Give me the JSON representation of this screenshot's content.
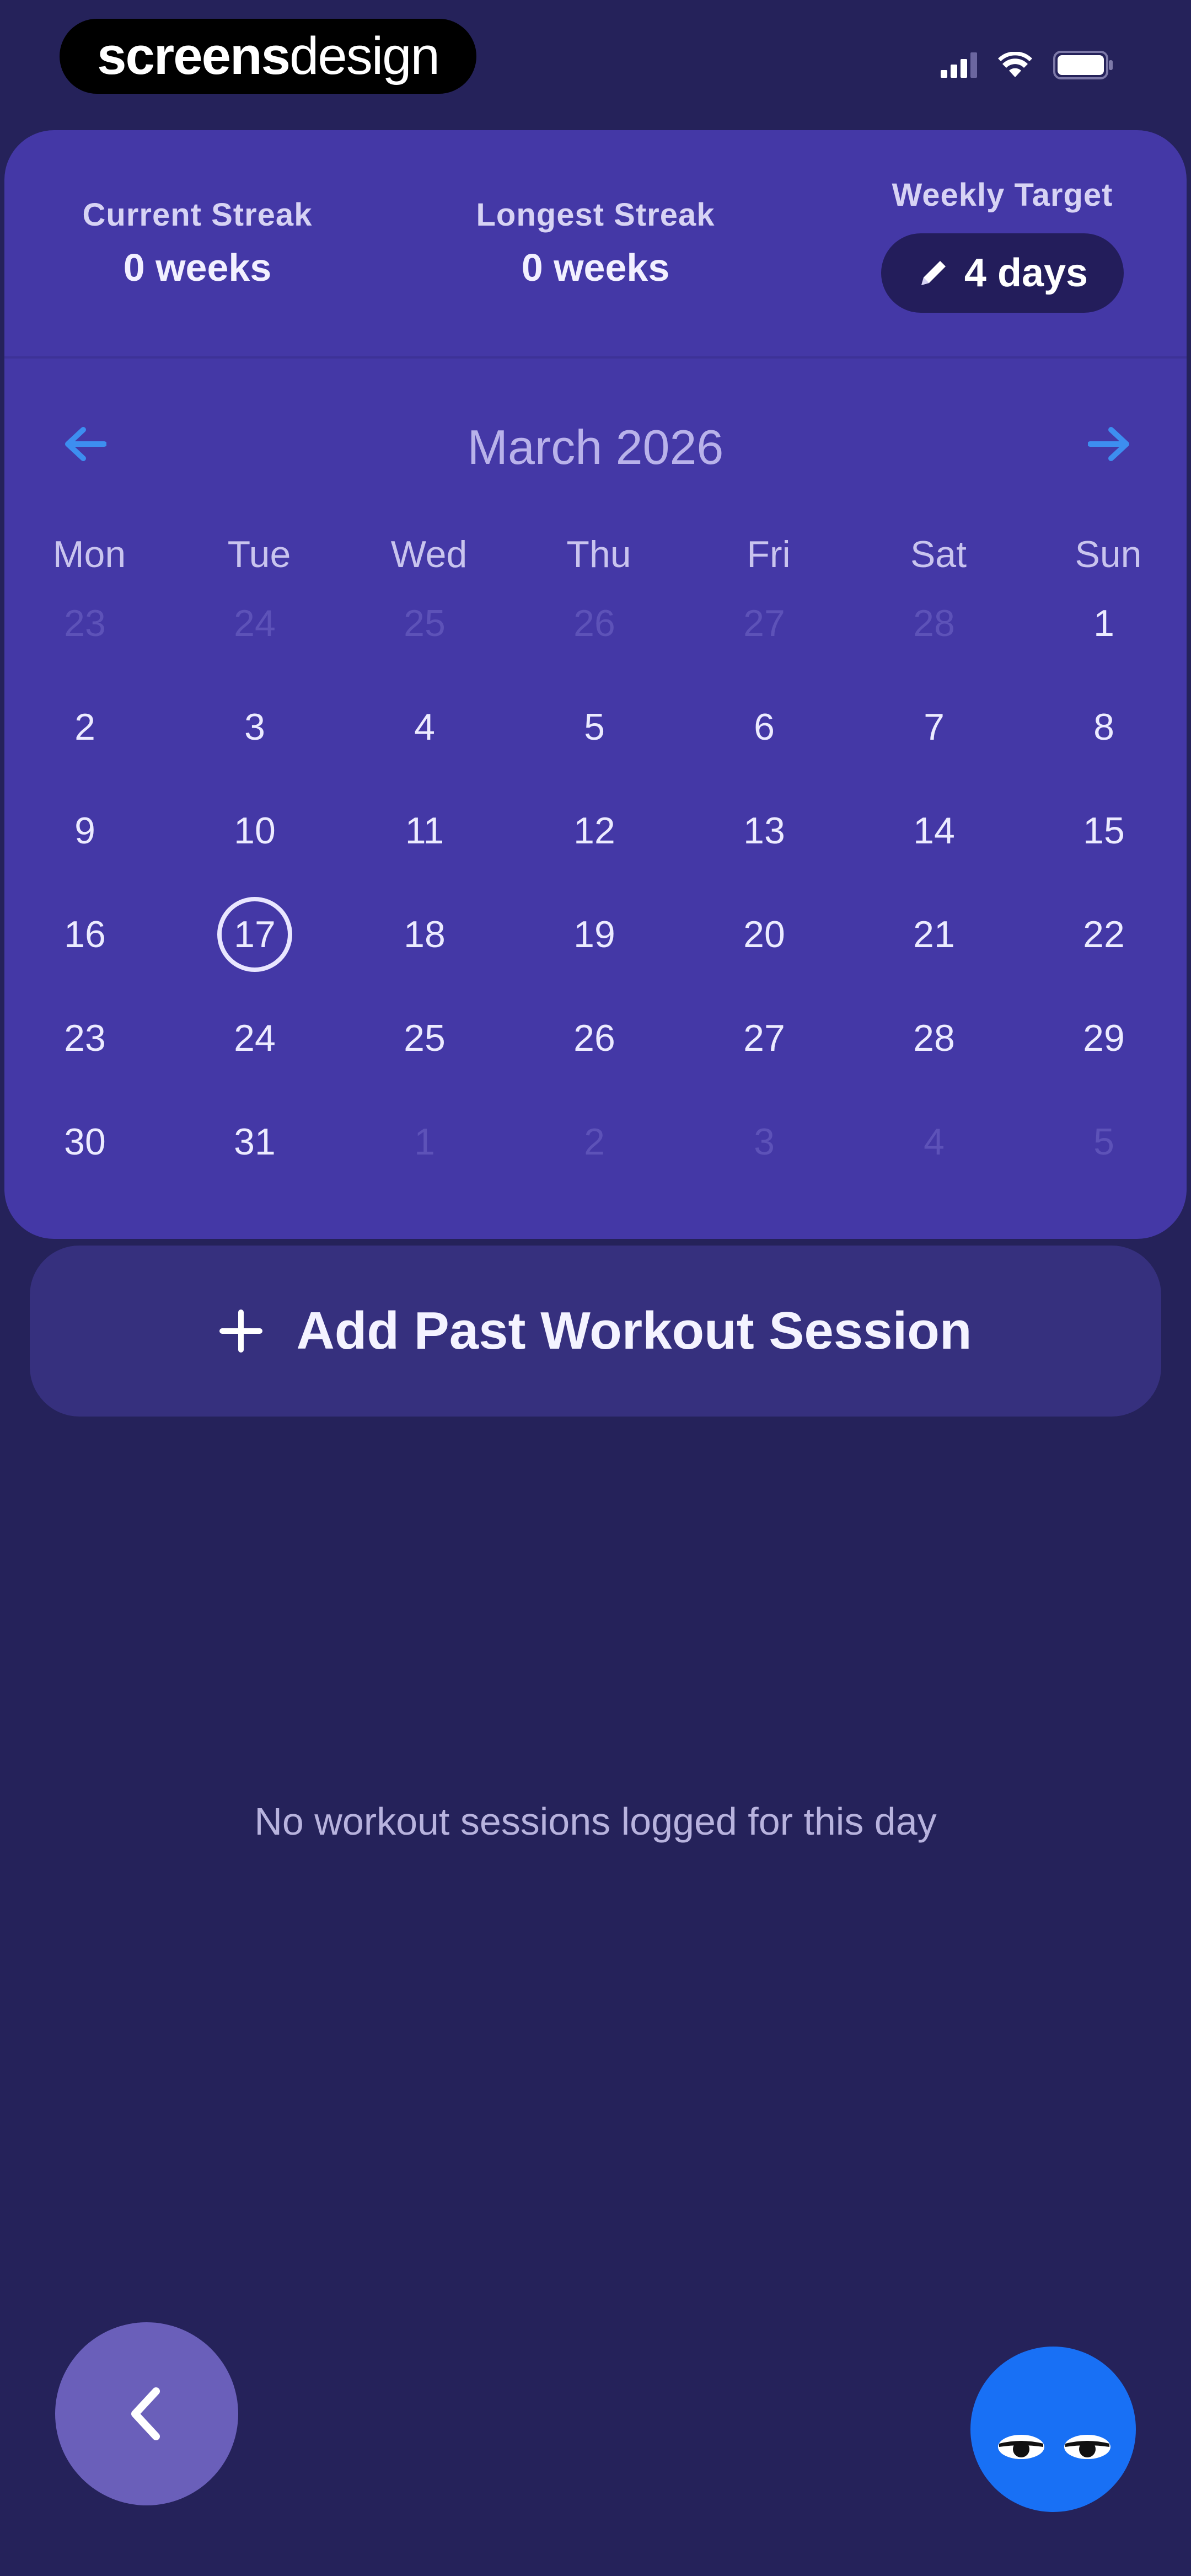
{
  "status_bar": {
    "brand_bold": "screens",
    "brand_light": "design"
  },
  "stats": {
    "current_streak": {
      "label": "Current Streak",
      "value": "0 weeks"
    },
    "longest_streak": {
      "label": "Longest Streak",
      "value": "0 weeks"
    },
    "weekly_target": {
      "label": "Weekly Target",
      "value": "4 days",
      "icon": "pencil-icon"
    }
  },
  "calendar": {
    "month_title": "March 2026",
    "prev_icon": "arrow-left-icon",
    "next_icon": "arrow-right-icon",
    "weekdays": [
      "Mon",
      "Tue",
      "Wed",
      "Thu",
      "Fri",
      "Sat",
      "Sun"
    ],
    "selected_day": "17",
    "weeks": [
      [
        "23",
        "24",
        "25",
        "26",
        "27",
        "28",
        "1"
      ],
      [
        "2",
        "3",
        "4",
        "5",
        "6",
        "7",
        "8"
      ],
      [
        "9",
        "10",
        "11",
        "12",
        "13",
        "14",
        "15"
      ],
      [
        "16",
        "17",
        "18",
        "19",
        "20",
        "21",
        "22"
      ],
      [
        "23",
        "24",
        "25",
        "26",
        "27",
        "28",
        "29"
      ],
      [
        "30",
        "31",
        "1",
        "2",
        "3",
        "4",
        "5"
      ]
    ]
  },
  "add_session": {
    "label": "Add Past Workout Session",
    "icon": "plus-icon"
  },
  "empty_state": {
    "message": "No workout sessions logged for this day"
  },
  "fab": {
    "back_icon": "chevron-left-icon",
    "mascot_icon": "mascot-eyes-icon"
  },
  "colors": {
    "background": "#25225a",
    "card": "#4438a6",
    "accent_blue": "#1870f5",
    "nav_arrow": "#3d8ef0",
    "back_button": "#6a5fba"
  }
}
